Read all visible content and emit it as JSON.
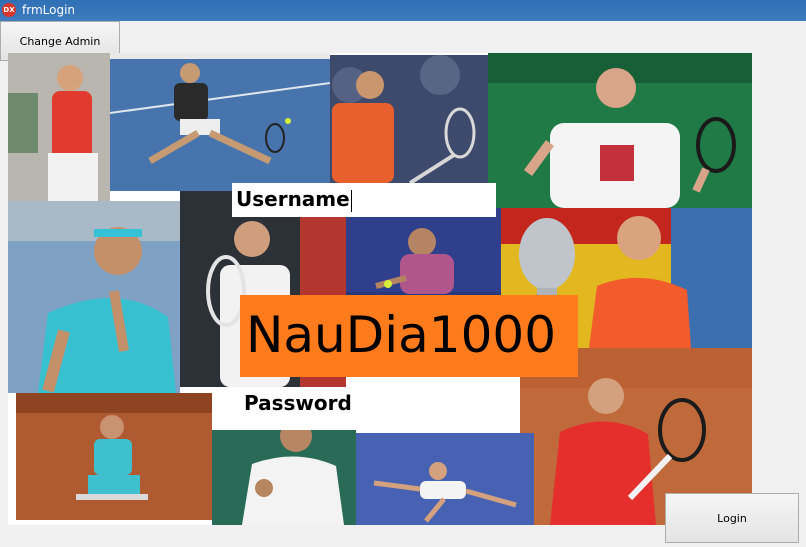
{
  "window": {
    "title": "frmLogin",
    "icon_text": "DX"
  },
  "buttons": {
    "change_admin": "Change Admin",
    "login": "Login"
  },
  "fields": {
    "username_label": "Username",
    "password_label": "Password"
  },
  "banner": {
    "text": "NauDia1000"
  },
  "photos": [
    {
      "name": "player-red-shirt"
    },
    {
      "name": "player-lunging-blue-court"
    },
    {
      "name": "player-orange-shirt-shouting"
    },
    {
      "name": "player-white-shirt-celebrating"
    },
    {
      "name": "player-cyan-headband"
    },
    {
      "name": "player-forehand-dark-bg"
    },
    {
      "name": "player-purple-shirt-stretching"
    },
    {
      "name": "player-trophy-flag"
    },
    {
      "name": "player-red-shirt-racquet-up"
    },
    {
      "name": "player-kneeling-clay"
    },
    {
      "name": "player-white-shirt-fist"
    },
    {
      "name": "player-lying-on-court"
    }
  ]
}
